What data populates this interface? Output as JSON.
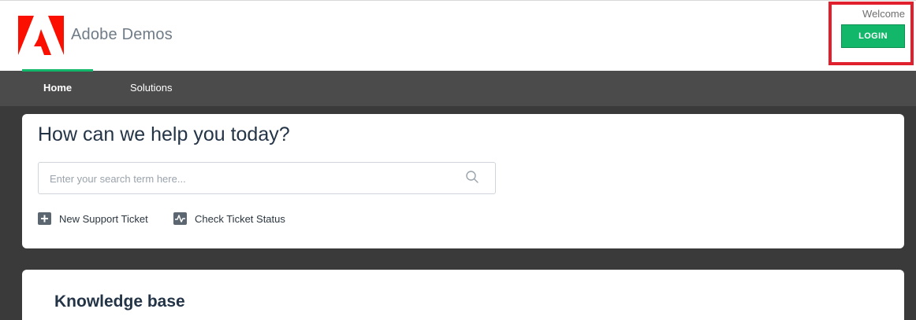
{
  "brand": {
    "name": "Adobe Demos",
    "logo_icon": "adobe-logo-icon",
    "logo_color": "#fa0f00"
  },
  "account": {
    "welcome_text": "Welcome",
    "login_label": "LOGIN",
    "login_color": "#12b76a"
  },
  "nav": {
    "items": [
      {
        "label": "Home",
        "active": true
      },
      {
        "label": "Solutions",
        "active": false
      }
    ]
  },
  "help": {
    "title": "How can we help you today?",
    "search_placeholder": "Enter your search term here...",
    "search_value": "",
    "actions": [
      {
        "label": "New Support Ticket",
        "icon": "plus-icon"
      },
      {
        "label": "Check Ticket Status",
        "icon": "activity-icon"
      }
    ]
  },
  "knowledge_base": {
    "title": "Knowledge base"
  },
  "colors": {
    "highlight": "#e0202d",
    "nav_bg": "#4b4b4b",
    "page_bg": "#3a3a3a",
    "heading": "#243447"
  }
}
